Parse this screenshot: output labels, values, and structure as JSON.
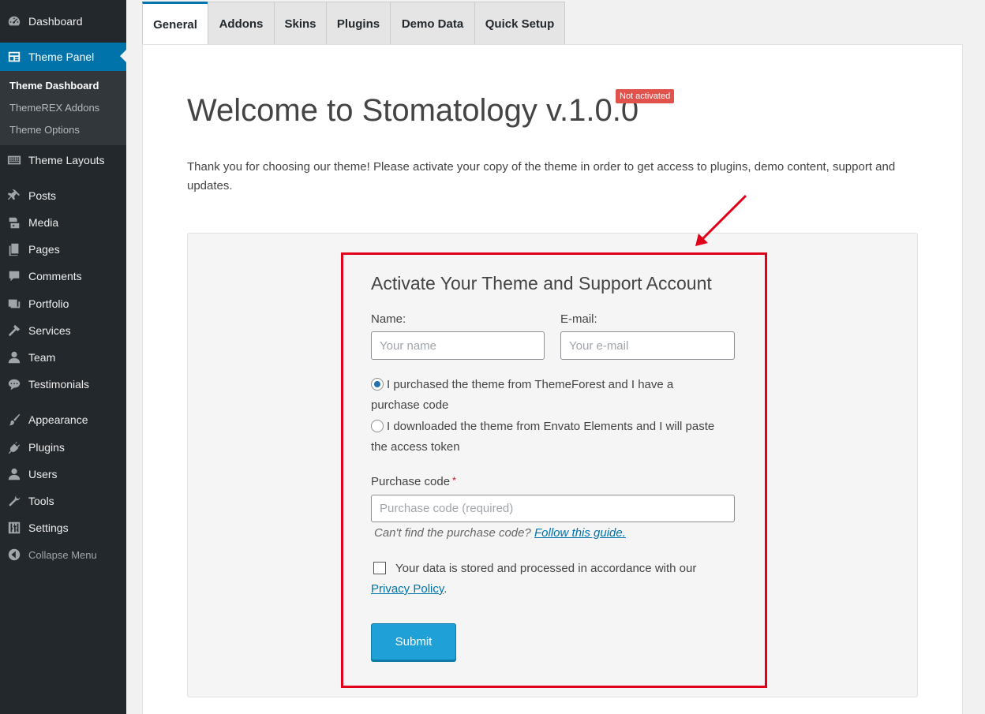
{
  "sidebar": {
    "items": [
      {
        "label": "Dashboard",
        "icon": "dashboard-icon"
      },
      {
        "label": "Theme Panel",
        "icon": "theme-panel-icon"
      },
      {
        "label": "Theme Layouts",
        "icon": "layouts-icon"
      },
      {
        "label": "Posts",
        "icon": "pin-icon"
      },
      {
        "label": "Media",
        "icon": "media-icon"
      },
      {
        "label": "Pages",
        "icon": "pages-icon"
      },
      {
        "label": "Comments",
        "icon": "comment-icon"
      },
      {
        "label": "Portfolio",
        "icon": "portfolio-icon"
      },
      {
        "label": "Services",
        "icon": "hammer-icon"
      },
      {
        "label": "Team",
        "icon": "user-icon"
      },
      {
        "label": "Testimonials",
        "icon": "chat-icon"
      },
      {
        "label": "Appearance",
        "icon": "brush-icon"
      },
      {
        "label": "Plugins",
        "icon": "plug-icon"
      },
      {
        "label": "Users",
        "icon": "users-icon"
      },
      {
        "label": "Tools",
        "icon": "wrench-icon"
      },
      {
        "label": "Settings",
        "icon": "settings-icon"
      },
      {
        "label": "Collapse Menu",
        "icon": "collapse-icon"
      }
    ],
    "submenu": [
      "Theme Dashboard",
      "ThemeREX Addons",
      "Theme Options"
    ]
  },
  "tabs": [
    "General",
    "Addons",
    "Skins",
    "Plugins",
    "Demo Data",
    "Quick Setup"
  ],
  "main": {
    "title": "Welcome to Stomatology v.1.0.0",
    "badge": "Not activated",
    "intro": "Thank you for choosing our theme! Please activate your copy of the theme in order to get access to plugins, demo content, support and updates."
  },
  "form": {
    "title": "Activate Your Theme and Support Account",
    "name_label": "Name:",
    "name_placeholder": "Your name",
    "email_label": "E-mail:",
    "email_placeholder": "Your e-mail",
    "radio1": "I purchased the theme from ThemeForest and I have a purchase code",
    "radio2": "I downloaded the theme from Envato Elements and I will paste the access token",
    "code_label": "Purchase code",
    "code_required": "*",
    "code_placeholder": "Purchase code (required)",
    "hint": "Can't find the purchase code?",
    "hint_link": "Follow this guide.",
    "consent": "Your data is stored and processed in accordance with our",
    "privacy_link": "Privacy Policy",
    "consent_end": ".",
    "submit": "Submit"
  },
  "colors": {
    "sidebar_bg": "#23282d",
    "accent": "#0073aa",
    "badge": "#e0524b",
    "highlight": "#e0001a",
    "submit": "#1fa0d6"
  }
}
